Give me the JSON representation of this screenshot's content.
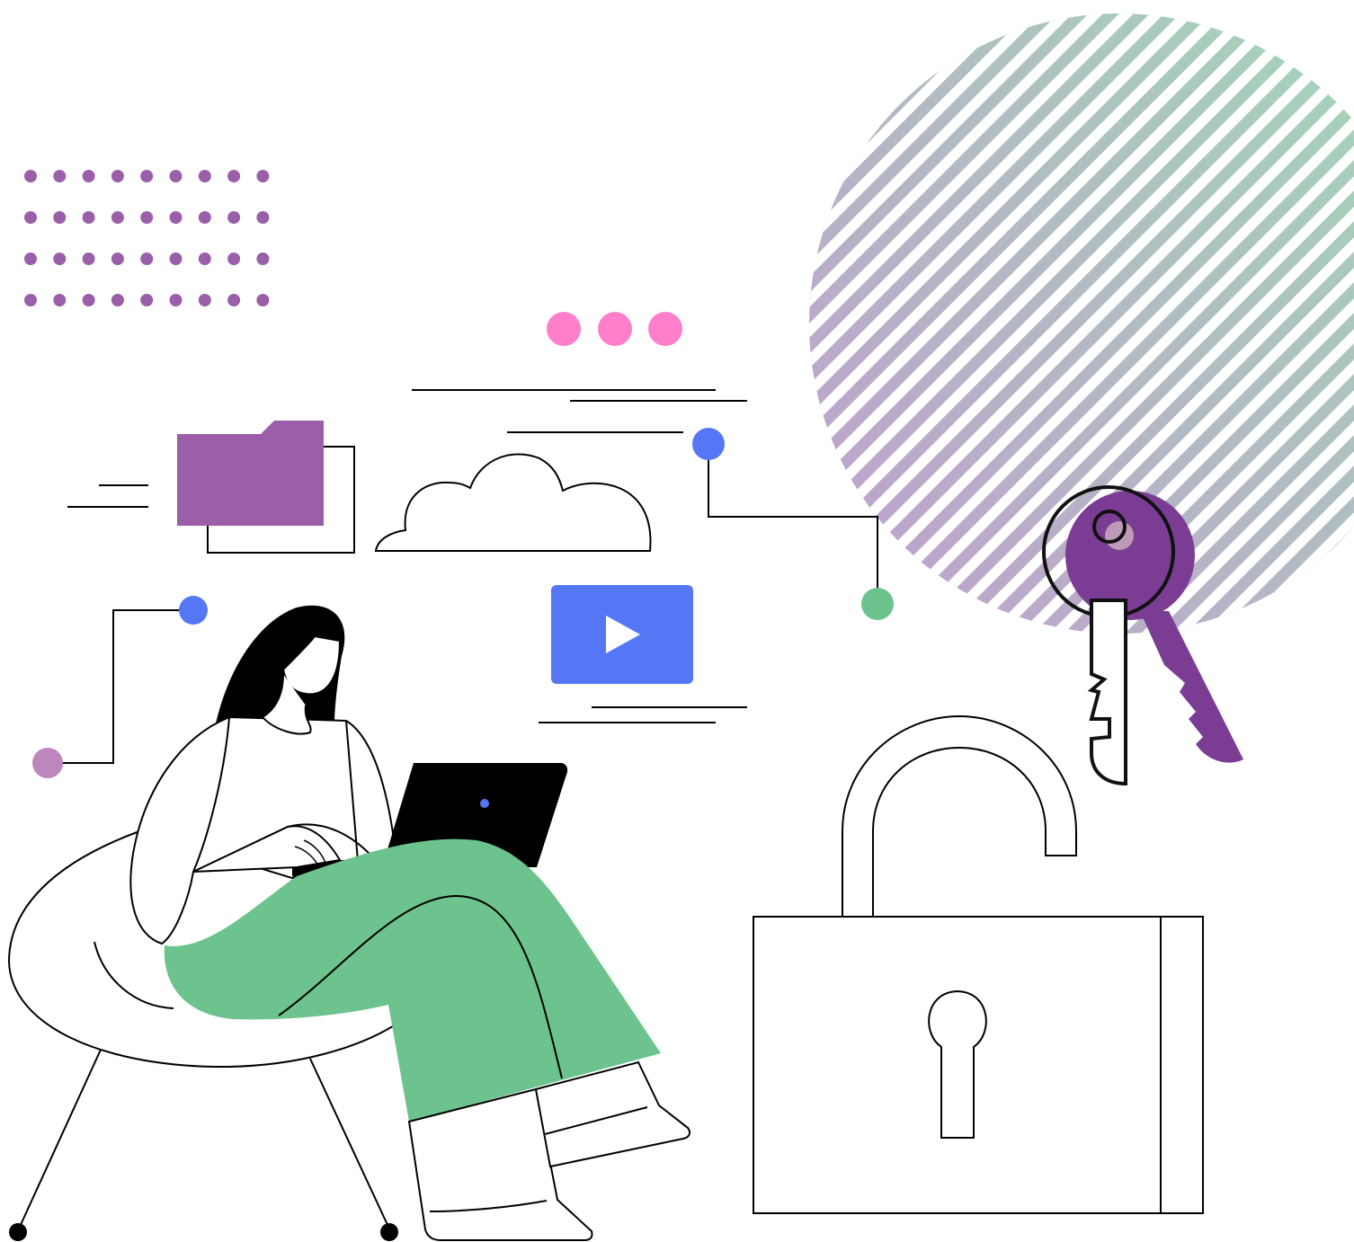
{
  "illustration": {
    "subject": "woman-with-laptop-security",
    "icons": [
      "dot-grid-icon",
      "folder-icon",
      "cloud-icon",
      "video-play-icon",
      "key-icon",
      "padlock-icon",
      "typing-dots-icon"
    ]
  },
  "colors": {
    "purple": "#9a5fa8",
    "key_purple": "#7b3d94",
    "pink": "#ff7fcb",
    "blue": "#5577f5",
    "green": "#6cc38d",
    "mauve": "#bd86bc",
    "stripe_start": "#c39bd0",
    "stripe_end": "#a3d6b8",
    "ink": "#000000"
  }
}
